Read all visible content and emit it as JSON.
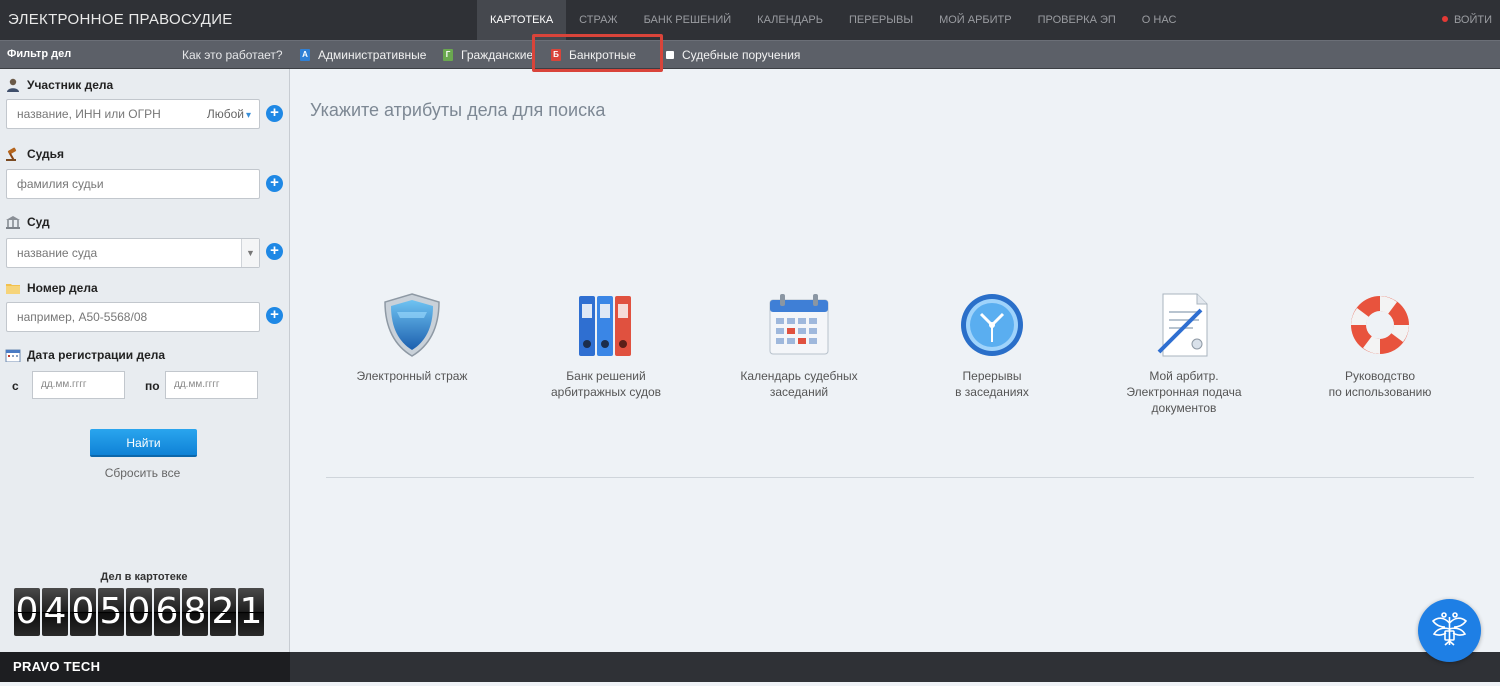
{
  "header": {
    "brand": "ЭЛЕКТРОННОЕ ПРАВОСУДИЕ",
    "nav": [
      "КАРТОТЕКА",
      "СТРАЖ",
      "БАНК РЕШЕНИЙ",
      "КАЛЕНДАРЬ",
      "ПЕРЕРЫВЫ",
      "МОЙ АРБИТР",
      "ПРОВЕРКА ЭП",
      "О НАС"
    ],
    "active_nav": "КАРТОТЕКА",
    "logout": "ВОЙТИ"
  },
  "filterbar": {
    "title": "Фильтр дел",
    "how": "Как это работает?",
    "types": [
      {
        "badge": "А",
        "label": "Административные",
        "color": "#2f80d6"
      },
      {
        "badge": "Г",
        "label": "Гражданские",
        "color": "#6aa84f"
      },
      {
        "badge": "Б",
        "label": "Банкротные",
        "color": "#d9443a"
      },
      {
        "badge": "",
        "label": "Судебные поручения",
        "color": "#ffffff"
      }
    ]
  },
  "sidebar": {
    "participant": {
      "label": "Участник дела",
      "placeholder": "название, ИНН или ОГРН",
      "selector": "Любой"
    },
    "judge": {
      "label": "Судья",
      "placeholder": "фамилия судьи"
    },
    "court": {
      "label": "Суд",
      "placeholder": "название суда"
    },
    "case_number": {
      "label": "Номер дела",
      "placeholder": "например, А50-5568/08"
    },
    "reg_date": {
      "label": "Дата регистрации дела",
      "from": "с",
      "to": "по",
      "from_placeholder": "дд.мм.гггг",
      "to_placeholder": "дд.мм.гггг"
    },
    "find_button": "Найти",
    "reset": "Сбросить все",
    "counter_title": "Дел в картотеке",
    "counter_digits": [
      "0",
      "4",
      "0",
      "5",
      "0",
      "6",
      "8",
      "2",
      "1"
    ]
  },
  "main": {
    "title": "Укажите атрибуты дела для поиска",
    "tiles": [
      {
        "lines": [
          "Электронный страж"
        ],
        "icon": "shield-icon"
      },
      {
        "lines": [
          "Банк решений",
          "арбитражных судов"
        ],
        "icon": "binders-icon"
      },
      {
        "lines": [
          "Календарь судебных",
          "заседаний"
        ],
        "icon": "calendar-icon"
      },
      {
        "lines": [
          "Перерывы",
          "в заседаниях"
        ],
        "icon": "clock-icon"
      },
      {
        "lines": [
          "Мой арбитр.",
          "Электронная подача",
          "документов"
        ],
        "icon": "document-pen-icon"
      },
      {
        "lines": [
          "Руководство",
          "по использованию"
        ],
        "icon": "lifebuoy-icon"
      }
    ]
  },
  "footer": {
    "brand": "PRAVO TECH"
  }
}
